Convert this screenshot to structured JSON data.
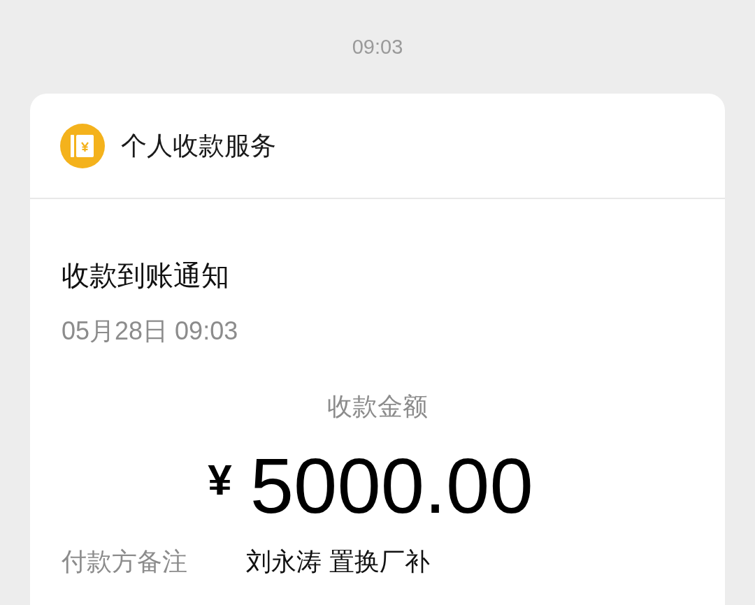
{
  "time": "09:03",
  "card": {
    "header": {
      "title": "个人收款服务"
    },
    "title": "收款到账通知",
    "date": "05月28日 09:03",
    "amount_label": "收款金额",
    "currency": "¥",
    "amount": "5000.00",
    "remark": {
      "label": "付款方备注",
      "value": "刘永涛 置换厂补"
    }
  }
}
